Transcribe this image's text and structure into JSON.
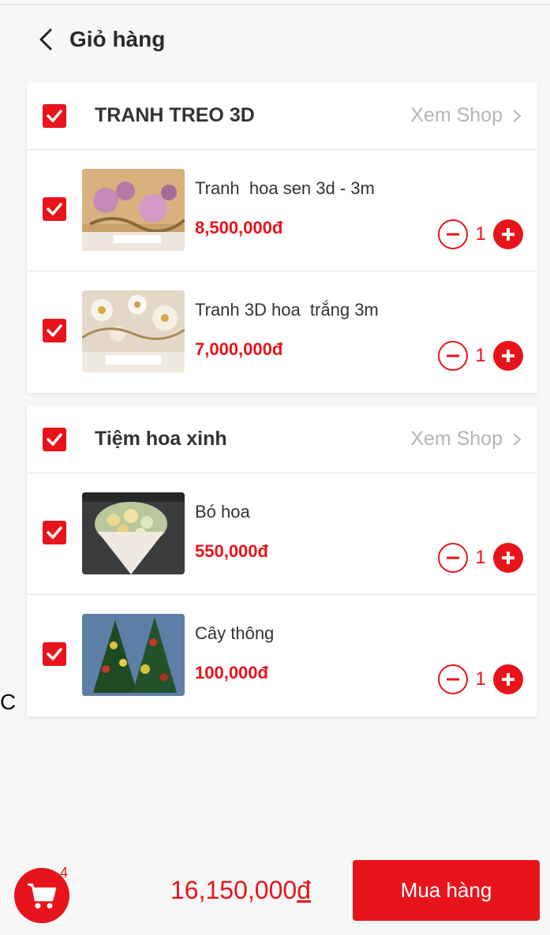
{
  "header": {
    "title": "Giỏ hàng",
    "back_icon": "chevron-left-icon"
  },
  "colors": {
    "accent": "#e8141b",
    "muted_text": "#b5b5b5",
    "background": "#f7f7f7"
  },
  "shops": [
    {
      "name": "TRANH TREO 3D",
      "view_shop_label": "Xem Shop",
      "checked": true,
      "items": [
        {
          "name": "Tranh  hoa sen 3d - 3m",
          "price": "8,500,000đ",
          "quantity": "1",
          "checked": true,
          "image": "lotus-wallpaper-image"
        },
        {
          "name": "Tranh 3D hoa  trắng 3m",
          "price": "7,000,000đ",
          "quantity": "1",
          "checked": true,
          "image": "white-flower-wallpaper-image"
        }
      ]
    },
    {
      "name": "Tiệm hoa xinh",
      "view_shop_label": "Xem Shop",
      "checked": true,
      "items": [
        {
          "name": "Bó hoa",
          "price": "550,000đ",
          "quantity": "1",
          "checked": true,
          "image": "flower-bouquet-image"
        },
        {
          "name": "Cây thông",
          "price": "100,000đ",
          "quantity": "1",
          "checked": true,
          "image": "christmas-tree-image"
        }
      ]
    }
  ],
  "edge_text": "C",
  "footer": {
    "cart_count": "4",
    "total_amount": "16,150,000",
    "total_currency": "đ",
    "buy_button_label": "Mua hàng"
  }
}
